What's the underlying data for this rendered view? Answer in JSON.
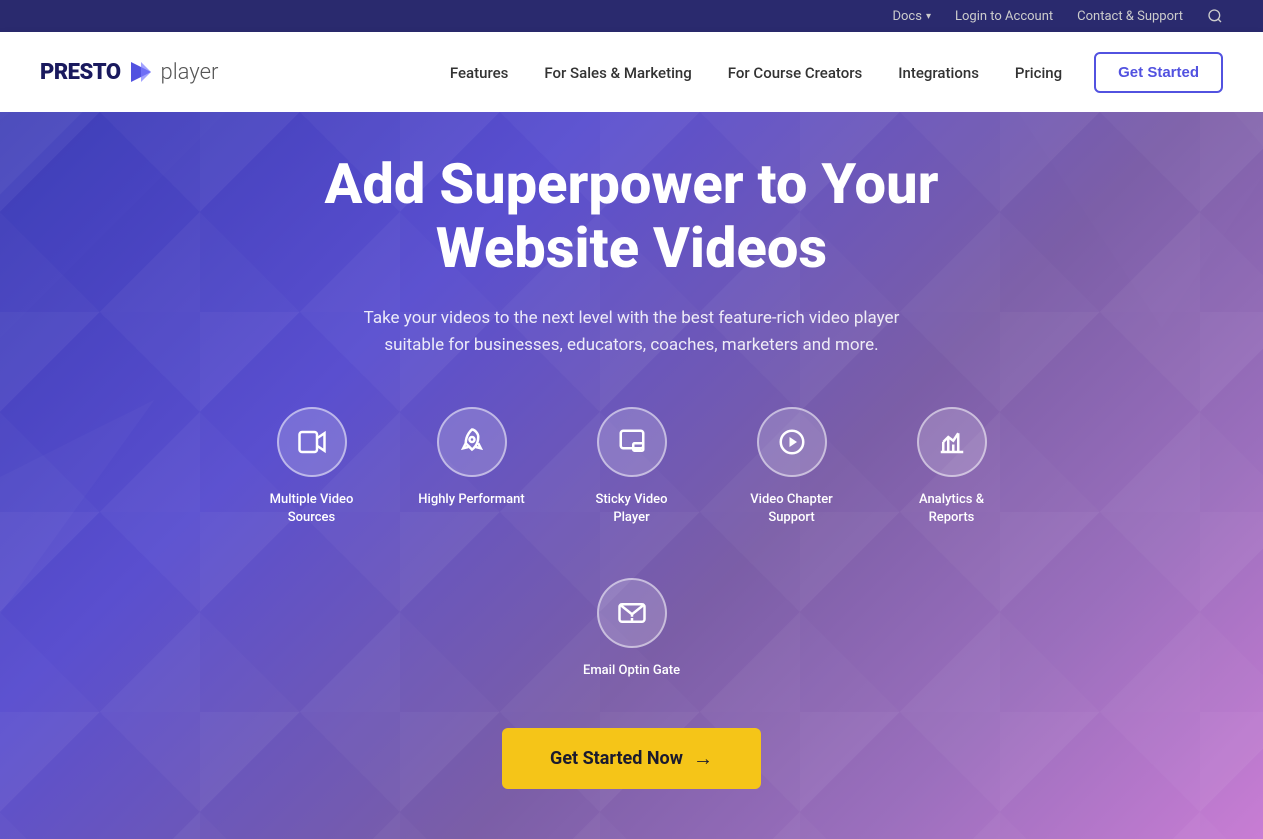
{
  "topbar": {
    "docs_label": "Docs",
    "login_label": "Login to Account",
    "support_label": "Contact & Support"
  },
  "navbar": {
    "logo_presto": "PRESTO",
    "logo_player": "player",
    "nav_items": [
      {
        "id": "features",
        "label": "Features"
      },
      {
        "id": "sales",
        "label": "For Sales & Marketing"
      },
      {
        "id": "course",
        "label": "For Course Creators"
      },
      {
        "id": "integrations",
        "label": "Integrations"
      },
      {
        "id": "pricing",
        "label": "Pricing"
      }
    ],
    "cta_label": "Get Started"
  },
  "hero": {
    "title_line1": "Add Superpower to Your",
    "title_line2": "Website Videos",
    "subtitle": "Take your videos to the next level with the best feature-rich video player suitable for businesses, educators, coaches, marketers and more.",
    "cta_label": "Get Started Now",
    "cta_arrow": "→"
  },
  "features": [
    {
      "id": "video-sources",
      "label": "Multiple Video Sources",
      "icon": "video"
    },
    {
      "id": "performant",
      "label": "Highly Performant",
      "icon": "rocket"
    },
    {
      "id": "sticky",
      "label": "Sticky Video Player",
      "icon": "pip"
    },
    {
      "id": "chapters",
      "label": "Video Chapter Support",
      "icon": "play-list"
    },
    {
      "id": "analytics",
      "label": "Analytics & Reports",
      "icon": "chart"
    },
    {
      "id": "optin",
      "label": "Email Optin Gate",
      "icon": "email"
    }
  ]
}
